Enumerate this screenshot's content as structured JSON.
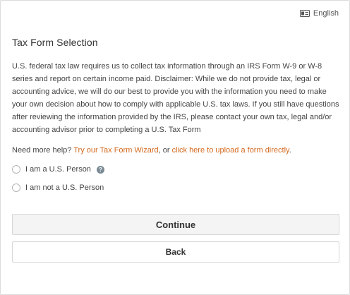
{
  "language": {
    "label": "English",
    "icon": "language-card-icon"
  },
  "form": {
    "title": "Tax Form Selection",
    "description": "U.S. federal tax law requires us to collect tax information through an IRS Form W-9 or W-8 series and report on certain income paid. Disclaimer: While we do not provide tax, legal or accounting advice, we will do our best to provide you with the information you need to make your own decision about how to comply with applicable U.S. tax laws. If you still have questions after reviewing the information provided by the IRS, please contact your own tax, legal and/or accounting advisor prior to completing a U.S. Tax Form",
    "help_prefix": "Need more help?",
    "help_link_wizard": "Try our Tax Form Wizard",
    "help_middle": ", or",
    "help_link_upload": "click here to upload a form directly",
    "help_suffix": ".",
    "options": [
      {
        "label": "I am a U.S. Person",
        "has_help_icon": true,
        "help_icon_glyph": "?"
      },
      {
        "label": "I am not a U.S. Person",
        "has_help_icon": false
      }
    ],
    "continue_label": "Continue",
    "back_label": "Back"
  },
  "colors": {
    "link": "#d4691e",
    "help_icon_bg": "#7a8a95"
  }
}
